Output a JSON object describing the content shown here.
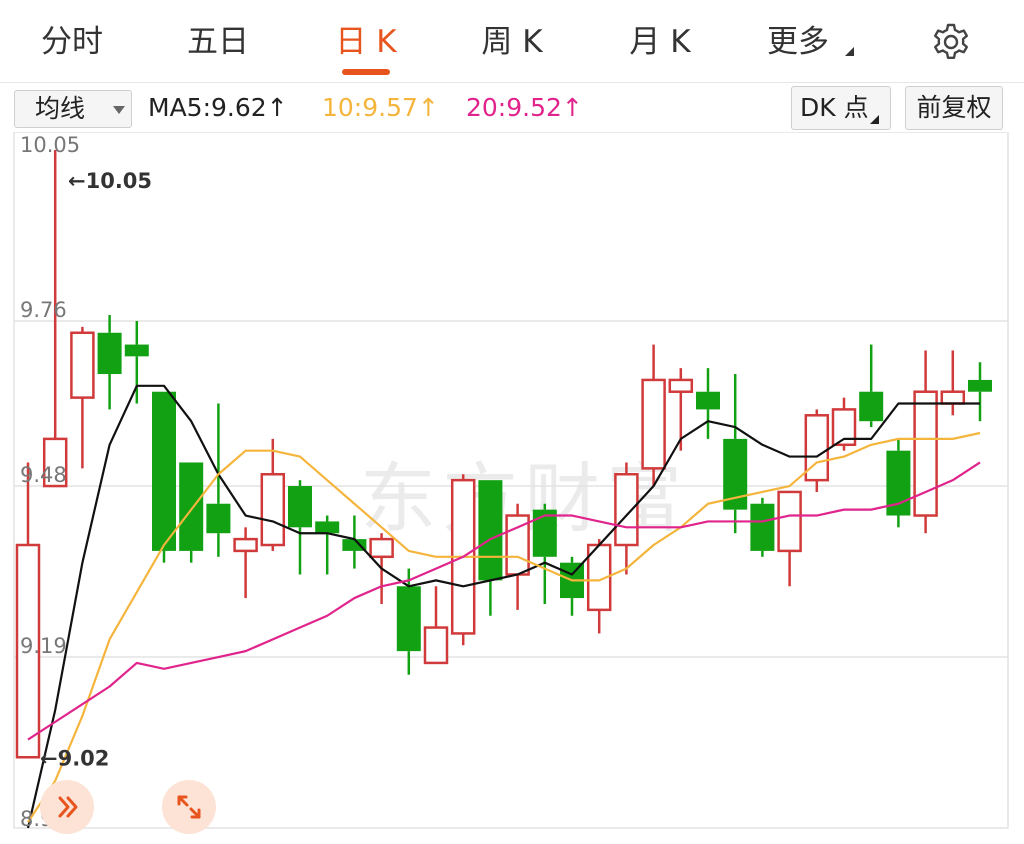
{
  "tabs": [
    {
      "label": "分时",
      "active": false
    },
    {
      "label": "五日",
      "active": false
    },
    {
      "label": "日 K",
      "active": true
    },
    {
      "label": "周 K",
      "active": false
    },
    {
      "label": "月 K",
      "active": false
    },
    {
      "label": "更多",
      "active": false
    }
  ],
  "indicator": {
    "selector": "均线",
    "ma5": "MA5:9.62↑",
    "ma10": "10:9.57↑",
    "ma20": "20:9.52↑",
    "dk_button": "DK 点",
    "adjust_button": "前复权"
  },
  "watermark": "东方财富",
  "colors": {
    "up": "#d03a3a",
    "down": "#12a112",
    "ma5": "#111111",
    "ma10": "#f5b53d",
    "ma20": "#e1248c",
    "accent": "#e8541e"
  },
  "chart_data": {
    "type": "candlestick",
    "ylim": [
      8.9,
      10.05
    ],
    "y_ticks": [
      10.05,
      9.76,
      9.48,
      9.19,
      8.9
    ],
    "y_tick_labels": [
      "10.05",
      "9.76",
      "9.48",
      "9.19",
      "8.90"
    ],
    "grid": true,
    "high_marker": "←10.05",
    "low_marker": "←9.02",
    "candles": [
      {
        "o": 9.02,
        "c": 9.38,
        "h": 9.52,
        "l": 9.02
      },
      {
        "o": 9.48,
        "c": 9.56,
        "h": 10.05,
        "l": 9.48
      },
      {
        "o": 9.63,
        "c": 9.74,
        "h": 9.75,
        "l": 9.51
      },
      {
        "o": 9.74,
        "c": 9.67,
        "h": 9.77,
        "l": 9.61
      },
      {
        "o": 9.72,
        "c": 9.7,
        "h": 9.76,
        "l": 9.62
      },
      {
        "o": 9.64,
        "c": 9.37,
        "h": 9.64,
        "l": 9.35
      },
      {
        "o": 9.52,
        "c": 9.37,
        "h": 9.52,
        "l": 9.35
      },
      {
        "o": 9.45,
        "c": 9.4,
        "h": 9.62,
        "l": 9.36
      },
      {
        "o": 9.37,
        "c": 9.39,
        "h": 9.41,
        "l": 9.29
      },
      {
        "o": 9.38,
        "c": 9.5,
        "h": 9.56,
        "l": 9.37
      },
      {
        "o": 9.48,
        "c": 9.41,
        "h": 9.49,
        "l": 9.33
      },
      {
        "o": 9.42,
        "c": 9.4,
        "h": 9.43,
        "l": 9.33
      },
      {
        "o": 9.39,
        "c": 9.37,
        "h": 9.43,
        "l": 9.34
      },
      {
        "o": 9.36,
        "c": 9.39,
        "h": 9.4,
        "l": 9.28
      },
      {
        "o": 9.31,
        "c": 9.2,
        "h": 9.34,
        "l": 9.16
      },
      {
        "o": 9.18,
        "c": 9.24,
        "h": 9.31,
        "l": 9.18
      },
      {
        "o": 9.23,
        "c": 9.49,
        "h": 9.5,
        "l": 9.21
      },
      {
        "o": 9.49,
        "c": 9.32,
        "h": 9.49,
        "l": 9.26
      },
      {
        "o": 9.33,
        "c": 9.43,
        "h": 9.45,
        "l": 9.27
      },
      {
        "o": 9.44,
        "c": 9.36,
        "h": 9.45,
        "l": 9.28
      },
      {
        "o": 9.35,
        "c": 9.29,
        "h": 9.36,
        "l": 9.26
      },
      {
        "o": 9.27,
        "c": 9.38,
        "h": 9.39,
        "l": 9.23
      },
      {
        "o": 9.38,
        "c": 9.5,
        "h": 9.52,
        "l": 9.33
      },
      {
        "o": 9.51,
        "c": 9.66,
        "h": 9.72,
        "l": 9.48
      },
      {
        "o": 9.64,
        "c": 9.66,
        "h": 9.68,
        "l": 9.54
      },
      {
        "o": 9.64,
        "c": 9.61,
        "h": 9.68,
        "l": 9.56
      },
      {
        "o": 9.56,
        "c": 9.44,
        "h": 9.67,
        "l": 9.4
      },
      {
        "o": 9.45,
        "c": 9.37,
        "h": 9.46,
        "l": 9.36
      },
      {
        "o": 9.37,
        "c": 9.47,
        "h": 9.47,
        "l": 9.31
      },
      {
        "o": 9.49,
        "c": 9.6,
        "h": 9.61,
        "l": 9.47
      },
      {
        "o": 9.55,
        "c": 9.61,
        "h": 9.63,
        "l": 9.54
      },
      {
        "o": 9.64,
        "c": 9.59,
        "h": 9.72,
        "l": 9.58
      },
      {
        "o": 9.54,
        "c": 9.43,
        "h": 9.56,
        "l": 9.41
      },
      {
        "o": 9.43,
        "c": 9.64,
        "h": 9.71,
        "l": 9.4
      },
      {
        "o": 9.62,
        "c": 9.64,
        "h": 9.71,
        "l": 9.6
      },
      {
        "o": 9.66,
        "c": 9.64,
        "h": 9.69,
        "l": 9.59
      }
    ],
    "series": [
      {
        "name": "MA5",
        "values": [
          8.9,
          9.1,
          9.35,
          9.55,
          9.65,
          9.65,
          9.59,
          9.5,
          9.43,
          9.42,
          9.4,
          9.4,
          9.39,
          9.34,
          9.31,
          9.32,
          9.31,
          9.32,
          9.33,
          9.35,
          9.33,
          9.38,
          9.43,
          9.48,
          9.56,
          9.59,
          9.58,
          9.55,
          9.53,
          9.53,
          9.56,
          9.56,
          9.62,
          9.62,
          9.62,
          9.62
        ]
      },
      {
        "name": "10",
        "values": [
          8.91,
          8.98,
          9.09,
          9.22,
          9.3,
          9.38,
          9.44,
          9.5,
          9.54,
          9.54,
          9.53,
          9.49,
          9.45,
          9.41,
          9.37,
          9.36,
          9.36,
          9.36,
          9.36,
          9.34,
          9.32,
          9.32,
          9.34,
          9.38,
          9.41,
          9.45,
          9.46,
          9.47,
          9.48,
          9.52,
          9.53,
          9.55,
          9.56,
          9.56,
          9.56,
          9.57
        ]
      },
      {
        "name": "20",
        "values": [
          9.05,
          9.08,
          9.11,
          9.14,
          9.18,
          9.17,
          9.18,
          9.19,
          9.2,
          9.22,
          9.24,
          9.26,
          9.29,
          9.31,
          9.32,
          9.34,
          9.36,
          9.39,
          9.41,
          9.43,
          9.43,
          9.42,
          9.41,
          9.41,
          9.41,
          9.42,
          9.42,
          9.42,
          9.43,
          9.43,
          9.44,
          9.44,
          9.45,
          9.47,
          9.49,
          9.52
        ]
      }
    ]
  }
}
